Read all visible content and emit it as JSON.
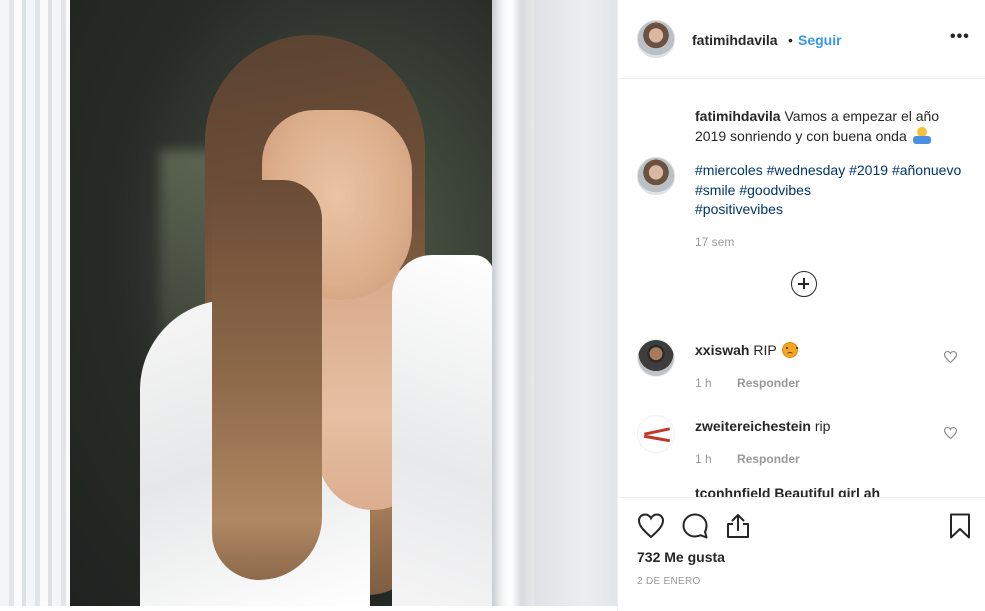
{
  "post": {
    "image_alt": "Smiling woman in a white shirt leaning on a window frame",
    "author": "fatimihdavila",
    "follow_separator": "•",
    "follow_label": "Seguir",
    "more_label": "•••"
  },
  "caption": {
    "username": "fatimihdavila",
    "text": "Vamos a empezar el año 2019 sonriendo y con buena onda",
    "emoji": "raising-hands-person-emoji"
  },
  "hashtags": {
    "tags": [
      "#miercoles",
      "#wednesday",
      "#2019",
      "#añonuevo",
      "#smile",
      "#goodvibes",
      "#positivevibes"
    ],
    "age": "17 sem"
  },
  "comments": [
    {
      "username": "xxiswah",
      "text": "RIP",
      "emoji": "disappointed-face-emoji",
      "age": "1 h",
      "reply_label": "Responder"
    },
    {
      "username": "zweitereichestein",
      "text": "rip",
      "age": "1 h",
      "reply_label": "Responder"
    }
  ],
  "partial_comment": "tconhnfield Beautiful girl ah",
  "actions": {
    "like_icon": "heart-icon",
    "comment_icon": "comment-icon",
    "share_icon": "share-icon",
    "save_icon": "bookmark-icon"
  },
  "likes": "732 Me gusta",
  "date": "2 DE ENERO",
  "colors": {
    "link": "#3897f0",
    "hashtag": "#003569",
    "muted": "#999999",
    "text": "#262626",
    "border": "#efefef"
  }
}
